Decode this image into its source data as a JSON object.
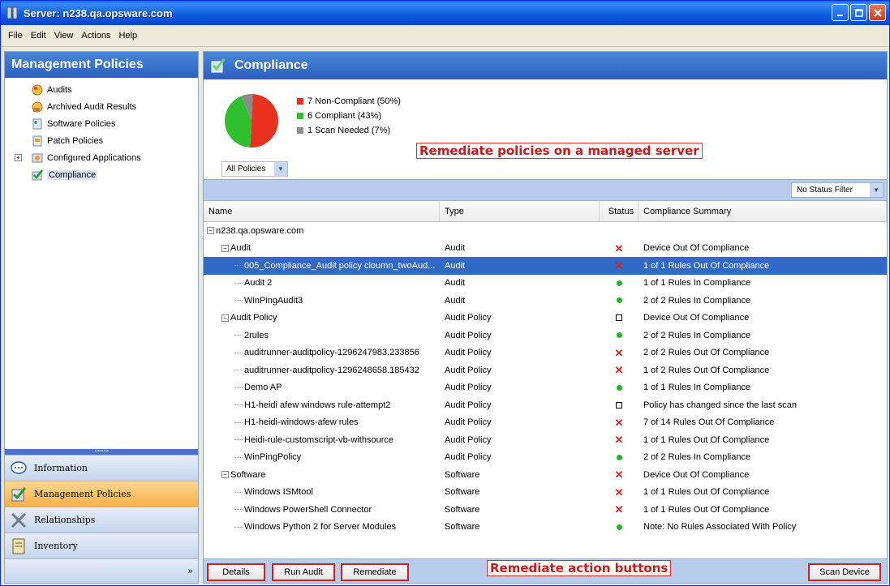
{
  "window": {
    "title": "Server: n238.qa.opsware.com"
  },
  "menu": [
    "File",
    "Edit",
    "View",
    "Actions",
    "Help"
  ],
  "left": {
    "header": "Management Policies",
    "tree": [
      {
        "label": "Audits",
        "icon": "audits-icon"
      },
      {
        "label": "Archived Audit Results",
        "icon": "archived-audit-icon"
      },
      {
        "label": "Software Policies",
        "icon": "software-policy-icon"
      },
      {
        "label": "Patch Policies",
        "icon": "patch-policy-icon"
      },
      {
        "label": "Configured Applications",
        "icon": "configured-apps-icon",
        "expandable": true
      },
      {
        "label": "Compliance",
        "icon": "compliance-icon",
        "selected": true
      }
    ],
    "nav": [
      {
        "label": "Information",
        "icon": "information-icon"
      },
      {
        "label": "Management Policies",
        "icon": "management-policies-icon",
        "active": true
      },
      {
        "label": "Relationships",
        "icon": "relationships-icon"
      },
      {
        "label": "Inventory",
        "icon": "inventory-icon"
      }
    ]
  },
  "right": {
    "header": "Compliance",
    "legend": [
      {
        "label": "7 Non-Compliant (50%)",
        "color": "#e8321e"
      },
      {
        "label": "6 Compliant (43%)",
        "color": "#2fbf2f"
      },
      {
        "label": "1 Scan Needed (7%)",
        "color": "#8c8c8c"
      }
    ],
    "pie": [
      {
        "value": 50,
        "color": "#e8321e"
      },
      {
        "value": 43,
        "color": "#2fbf2f"
      },
      {
        "value": 7,
        "color": "#8c8c8c"
      }
    ],
    "policy_filter": "All Policies",
    "status_filter": "No Status Filter",
    "annotation_top": "Remediate policies on a managed server",
    "annotation_bottom": "Remediate action buttons",
    "columns": {
      "name": "Name",
      "type": "Type",
      "status": "Status",
      "summary": "Compliance Summary"
    },
    "rows": [
      {
        "level": 0,
        "expander": "−",
        "name": "n238.qa.opsware.com",
        "type": "",
        "status": "",
        "summary": ""
      },
      {
        "level": 1,
        "expander": "−",
        "name": "Audit",
        "type": "Audit",
        "status": "x",
        "summary": "Device Out Of Compliance"
      },
      {
        "level": 2,
        "name": "005_Compliance_Audit policy cloumn_twoAud...",
        "type": "Audit",
        "status": "x",
        "summary": "1 of 1 Rules Out Of Compliance",
        "selected": true
      },
      {
        "level": 2,
        "name": "Audit 2",
        "type": "Audit",
        "status": "ok",
        "summary": "1 of 1 Rules In Compliance"
      },
      {
        "level": 2,
        "name": "WinPingAudit3",
        "type": "Audit",
        "status": "ok",
        "summary": "2 of 2 Rules In Compliance"
      },
      {
        "level": 1,
        "expander": "−",
        "name": "Audit Policy",
        "type": "Audit Policy",
        "status": "scan",
        "summary": "Device Out Of Compliance"
      },
      {
        "level": 2,
        "name": "2rules",
        "type": "Audit Policy",
        "status": "ok",
        "summary": "2 of 2 Rules In Compliance"
      },
      {
        "level": 2,
        "name": "auditrunner-auditpolicy-1296247983.233856",
        "type": "Audit Policy",
        "status": "x",
        "summary": "2 of 2 Rules Out Of Compliance"
      },
      {
        "level": 2,
        "name": "auditrunner-auditpolicy-1296248658.185432",
        "type": "Audit Policy",
        "status": "x",
        "summary": "1 of 2 Rules Out Of Compliance"
      },
      {
        "level": 2,
        "name": "Demo AP",
        "type": "Audit Policy",
        "status": "ok",
        "summary": "1 of 1 Rules In Compliance"
      },
      {
        "level": 2,
        "name": "H1-heidi afew windows rule-attempt2",
        "type": "Audit Policy",
        "status": "scan",
        "summary": "Policy has changed since the last scan"
      },
      {
        "level": 2,
        "name": "H1-heidi-windows-afew rules",
        "type": "Audit Policy",
        "status": "x",
        "summary": "7 of 14 Rules Out Of Compliance"
      },
      {
        "level": 2,
        "name": "Heidi-rule-customscript-vb-withsource",
        "type": "Audit Policy",
        "status": "x",
        "summary": "1 of 1 Rules Out Of Compliance"
      },
      {
        "level": 2,
        "name": "WinPingPolicy",
        "type": "Audit Policy",
        "status": "ok",
        "summary": "2 of 2 Rules In Compliance"
      },
      {
        "level": 1,
        "expander": "−",
        "name": "Software",
        "type": "Software",
        "status": "x",
        "summary": "Device Out Of Compliance"
      },
      {
        "level": 2,
        "name": "Windows ISMtool",
        "type": "Software",
        "status": "x",
        "summary": "1 of 1 Rules Out Of Compliance"
      },
      {
        "level": 2,
        "name": "Windows PowerShell Connector",
        "type": "Software",
        "status": "x",
        "summary": "1 of 1 Rules Out Of Compliance"
      },
      {
        "level": 2,
        "name": "Windows Python 2 for Server Modules",
        "type": "Software",
        "status": "ok",
        "summary": "Note: No Rules Associated With Policy"
      }
    ],
    "buttons": {
      "details": "Details",
      "run_audit": "Run Audit",
      "remediate": "Remediate",
      "scan_device": "Scan Device"
    }
  }
}
